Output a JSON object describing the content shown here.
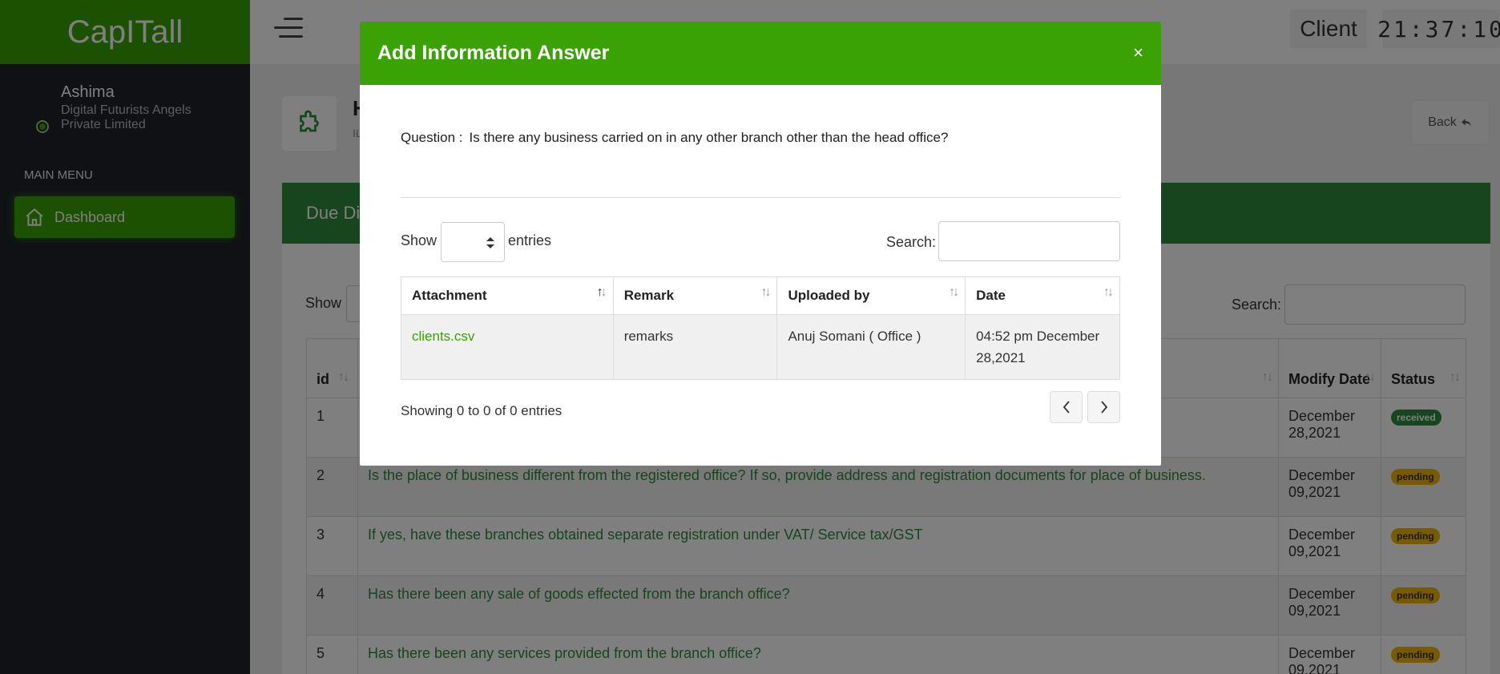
{
  "app": {
    "brand": "CapITall",
    "user_name": "Ashima",
    "user_org": "Digital Futurists Angels Private Limited",
    "menu_header": "MAIN MENU",
    "menu_items": [
      {
        "label": "Dashboard",
        "icon": "home-icon"
      }
    ]
  },
  "topbar": {
    "role": "Client",
    "clock": "21:37:10"
  },
  "page": {
    "title": "H",
    "subtitle": "IL",
    "back_label": "Back",
    "card_title": "Due Di",
    "show_label": "Show",
    "search_label": "Search:",
    "columns": [
      "id",
      "",
      "Modify Date",
      "Status"
    ],
    "rows": [
      {
        "id": "1",
        "question": "",
        "date": "December 28,2021",
        "status": "received"
      },
      {
        "id": "2",
        "question": "Is the place of business different from the registered office? If so, provide address and registration documents for place of business.",
        "date": "December 09,2021",
        "status": "pending"
      },
      {
        "id": "3",
        "question": "If yes, have these branches obtained separate registration under VAT/ Service tax/GST",
        "date": "December 09,2021",
        "status": "pending"
      },
      {
        "id": "4",
        "question": "Has there been any sale of goods effected from the branch office?",
        "date": "December 09,2021",
        "status": "pending"
      },
      {
        "id": "5",
        "question": "Has there been any services provided from the branch office?",
        "date": "December 09,2021",
        "status": "pending"
      }
    ]
  },
  "modal": {
    "title": "Add Information Answer",
    "close": "×",
    "question_label": "Question :",
    "question_text": "Is there any business carried on in any other branch other than the head office?",
    "show_label": "Show",
    "entries_label": "entries",
    "search_label": "Search:",
    "columns": [
      "Attachment",
      "Remark",
      "Uploaded by",
      "Date"
    ],
    "rows": [
      {
        "attachment": "clients.csv",
        "remark": "remarks",
        "uploaded_by": "Anuj Somani ( Office )",
        "date": "04:52 pm December 28,2021"
      }
    ],
    "info": "Showing 0 to 0 of 0 entries"
  },
  "colors": {
    "brand_green": "#3aa205",
    "dark_green": "#2e8b3a",
    "sidebar": "#1e2329",
    "pending": "#f0b400"
  }
}
